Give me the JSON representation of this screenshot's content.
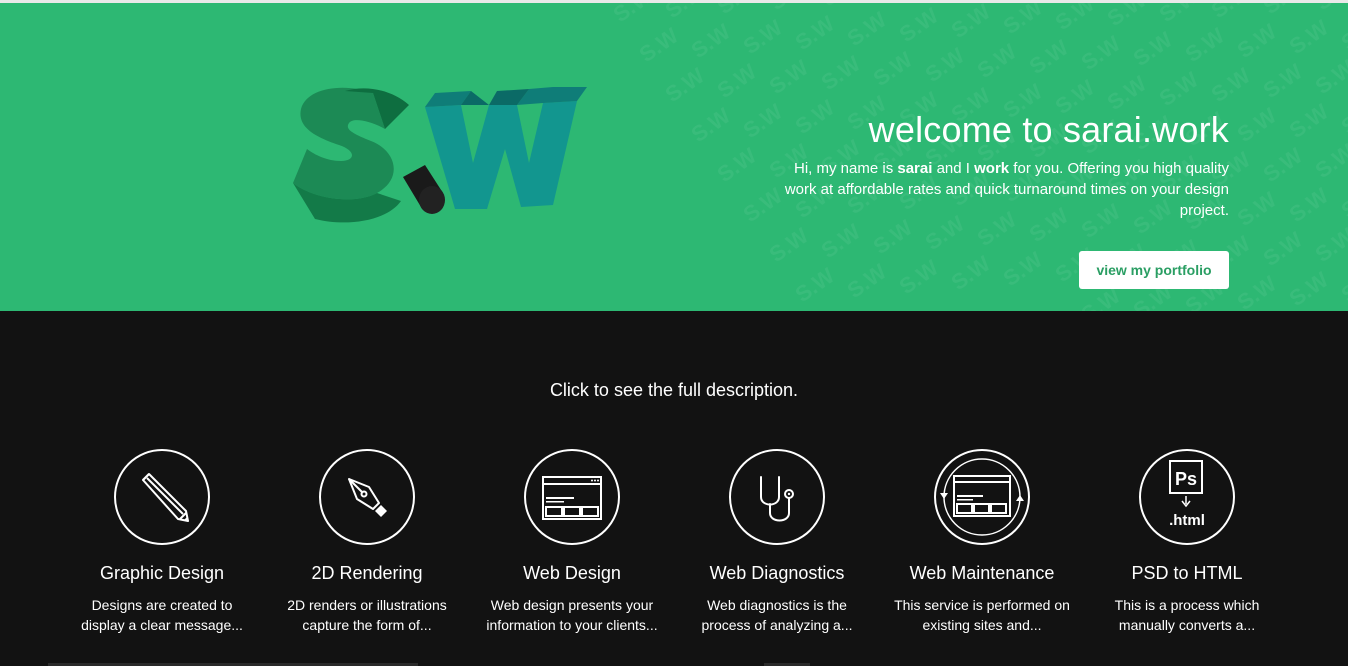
{
  "hero": {
    "logo_alt": "S.W",
    "title": "welcome to sarai.work",
    "intro_pre": "Hi, my name is ",
    "intro_name": "sarai",
    "intro_mid": " and I ",
    "intro_work": "work",
    "intro_post": " for you. Offering you high quality work at affordable rates and quick turnaround times on your design project.",
    "cta_label": "view my portfolio",
    "pattern_text": "S.W",
    "background_color": "#2db873"
  },
  "services": {
    "intro": "Click to see the full description.",
    "items": [
      {
        "icon": "pencil-icon",
        "title": "Graphic Design",
        "desc": "Designs are created to display a clear message..."
      },
      {
        "icon": "pen-tool-icon",
        "title": "2D Rendering",
        "desc": "2D renders or illustrations capture the form of..."
      },
      {
        "icon": "browser-window-icon",
        "title": "Web Design",
        "desc": "Web design presents your information to your clients..."
      },
      {
        "icon": "stethoscope-icon",
        "title": "Web Diagnostics",
        "desc": "Web diagnostics is the process of analyzing a..."
      },
      {
        "icon": "browser-refresh-icon",
        "title": "Web Maintenance",
        "desc": "This service is performed on existing sites and..."
      },
      {
        "icon": "psd-to-html-icon",
        "title": "PSD to HTML",
        "desc": "This is a process which manually converts a..."
      }
    ]
  },
  "psd_icon": {
    "ps_label": "Ps",
    "html_label": ".html"
  }
}
